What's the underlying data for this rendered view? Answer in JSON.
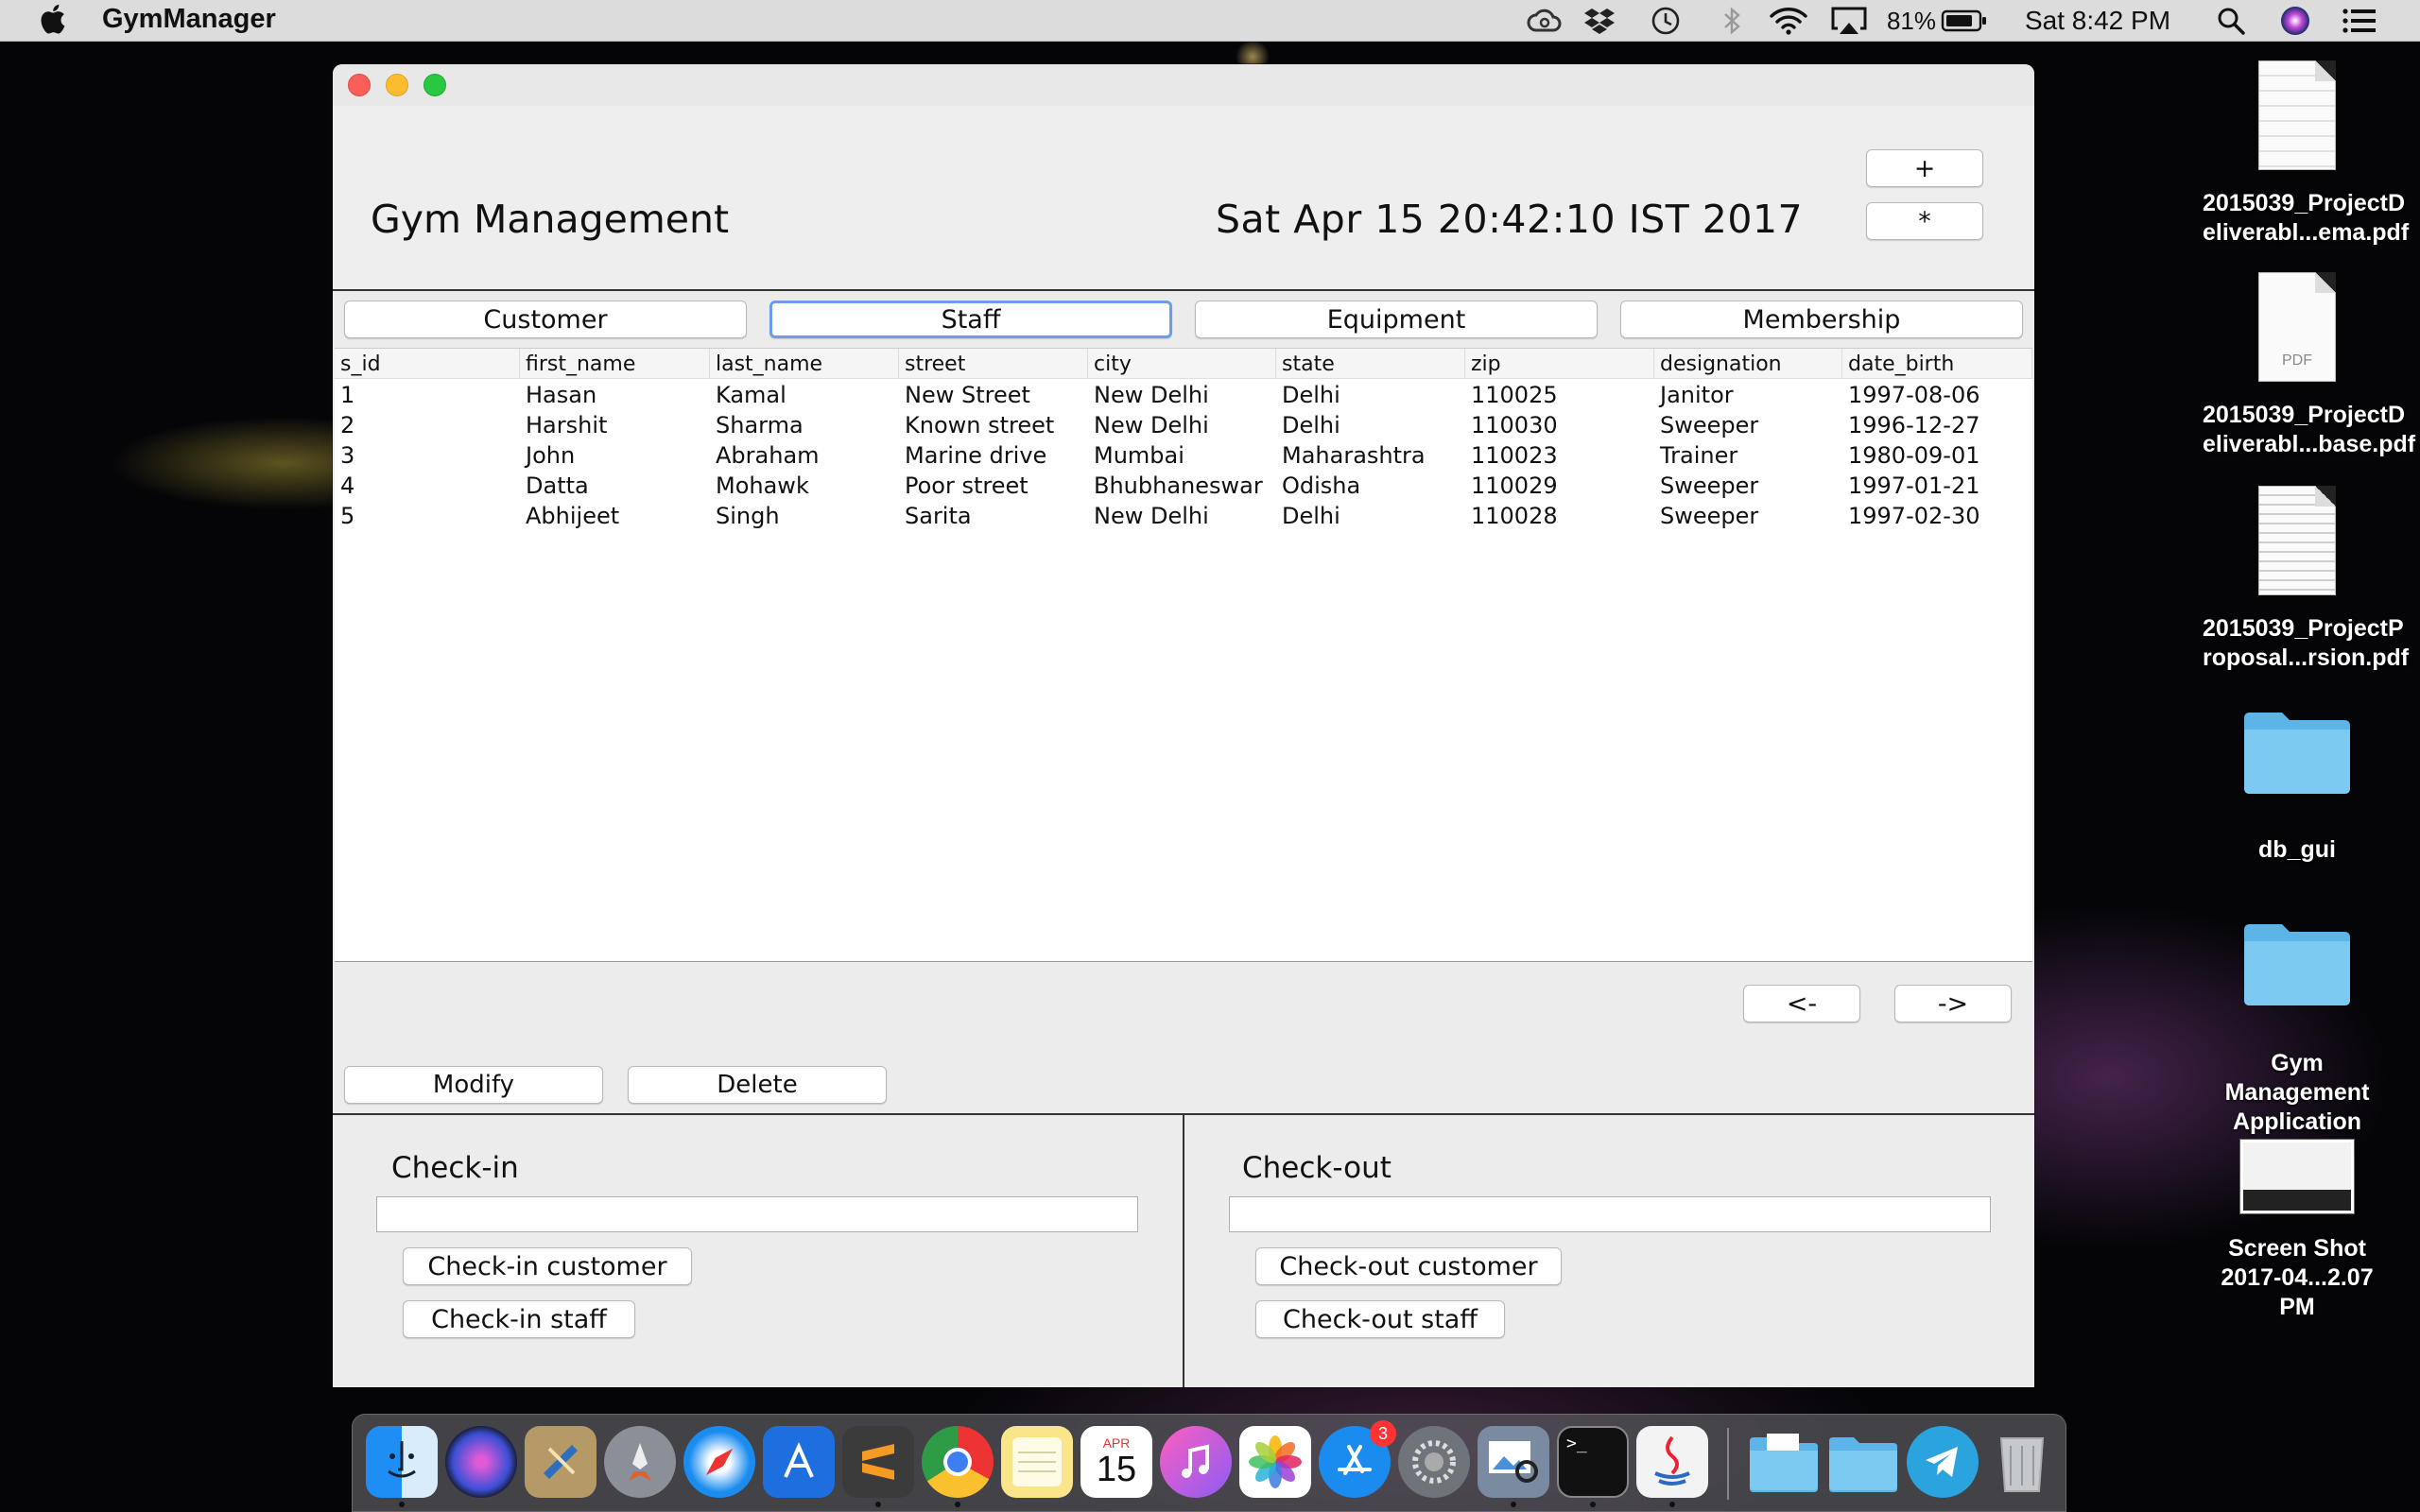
{
  "menubar": {
    "app_name": "GymManager",
    "battery": "81%",
    "clock": "Sat 8:42 PM"
  },
  "window": {
    "title": "Gym Management",
    "datetime": "Sat Apr 15 20:42:10 IST 2017",
    "plus_label": "+",
    "star_label": "*",
    "tabs": [
      {
        "label": "Customer"
      },
      {
        "label": "Staff"
      },
      {
        "label": "Equipment"
      },
      {
        "label": "Membership"
      }
    ],
    "table": {
      "columns": [
        "s_id",
        "first_name",
        "last_name",
        "street",
        "city",
        "state",
        "zip",
        "designation",
        "date_birth"
      ],
      "rows": [
        [
          "1",
          "Hasan",
          "Kamal",
          "New Street",
          "New Delhi",
          "Delhi",
          "110025",
          "Janitor",
          "1997-08-06"
        ],
        [
          "2",
          "Harshit",
          "Sharma",
          "Known street",
          "New Delhi",
          "Delhi",
          "110030",
          "Sweeper",
          "1996-12-27"
        ],
        [
          "3",
          "John",
          "Abraham",
          "Marine drive",
          "Mumbai",
          "Maharashtra",
          "110023",
          "Trainer",
          "1980-09-01"
        ],
        [
          "4",
          "Datta",
          "Mohawk",
          "Poor street",
          "Bhubhaneswar",
          "Odisha",
          "110029",
          "Sweeper",
          "1997-01-21"
        ],
        [
          "5",
          "Abhijeet",
          "Singh",
          "Sarita",
          "New Delhi",
          "Delhi",
          "110028",
          "Sweeper",
          "1997-02-30"
        ]
      ]
    },
    "prev_label": "<-",
    "next_label": "->",
    "modify_label": "Modify",
    "delete_label": "Delete",
    "checkin": {
      "title": "Check-in",
      "input_value": "",
      "customer_btn": "Check-in customer",
      "staff_btn": "Check-in staff"
    },
    "checkout": {
      "title": "Check-out",
      "input_value": "",
      "customer_btn": "Check-out customer",
      "staff_btn": "Check-out staff"
    }
  },
  "desktop": {
    "items": [
      {
        "label": "2015039_ProjectD eliverabl...ema.pdf",
        "icon": "pdf-document-icon"
      },
      {
        "label": "2015039_ProjectD eliverabl...base.pdf",
        "icon": "pdf-document-icon",
        "sublabel": "PDF"
      },
      {
        "label": "2015039_ProjectP roposal...rsion.pdf",
        "icon": "pdf-document-icon"
      },
      {
        "label": "db_gui",
        "icon": "folder-icon"
      },
      {
        "label": "Gym Management Application",
        "icon": "folder-icon"
      },
      {
        "label": "Screen Shot 2017-04...2.07 PM",
        "icon": "screenshot-icon"
      }
    ]
  },
  "dock": {
    "calendar_month": "APR",
    "calendar_day": "15",
    "appstore_badge": "3",
    "terminal_prompt": ">_"
  }
}
